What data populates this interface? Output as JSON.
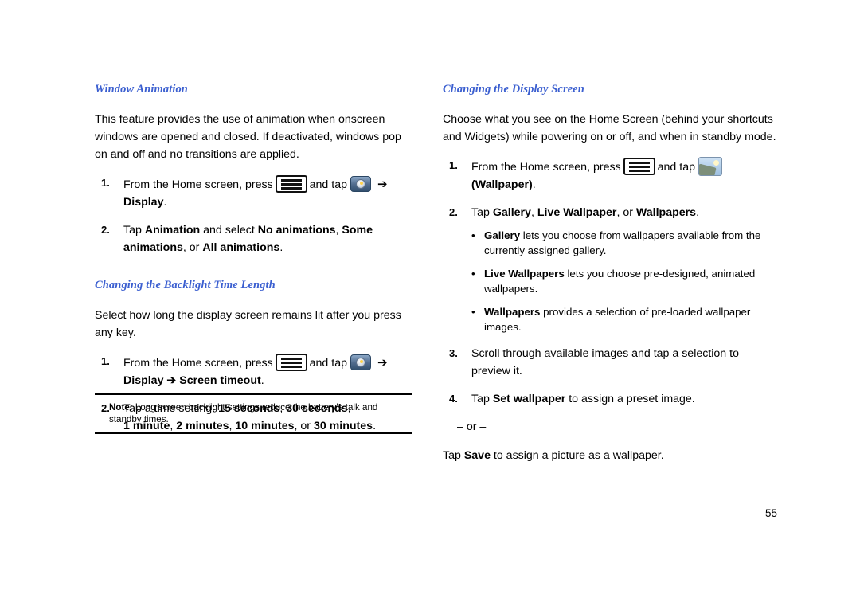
{
  "page": {
    "number": "55"
  },
  "left_column": {
    "section1": {
      "heading": "Window Animation",
      "intro": "This feature provides the use of animation when onscreen windows are opened and closed. If deactivated, windows pop on and off and no transitions are applied.",
      "steps": [
        {
          "num": "1.",
          "pre": "From the Home screen, press",
          "mid": "and tap",
          "post": "Display",
          "post_tail": "."
        },
        {
          "num": "2.",
          "t1": "Tap ",
          "b1": "Animation",
          "t2": " and select ",
          "b2": "No animations",
          "t3": ", ",
          "b3": "Some animations",
          "t4": ", or ",
          "b4": "All animations",
          "t5": "."
        }
      ]
    },
    "section2": {
      "heading": "Changing the Backlight Time Length",
      "intro": "Select how long the display screen remains lit after you press any key.",
      "steps": [
        {
          "num": "1.",
          "pre": "From the Home screen, press",
          "mid": "and tap",
          "post": "Display ➔ Screen timeout",
          "post_tail": "."
        },
        {
          "num": "2.",
          "t1": "Tap a time setting: ",
          "b1": "15 seconds",
          "t2": ", ",
          "b2": "30 seconds",
          "t3": ", ",
          "b3": "1 minute",
          "t4": ", ",
          "b4": "2 minutes",
          "t5": ", ",
          "b5": "10 minutes",
          "t6": ", or ",
          "b6": "30 minutes",
          "t7": "."
        }
      ]
    },
    "note": {
      "label": "Note:",
      "text": "Long screen backlight settings reduce the battery's talk and standby times."
    }
  },
  "right_column": {
    "section1": {
      "heading": "Changing the Display Screen",
      "intro": "Choose what you see on the Home Screen (behind your shortcuts and Widgets) while powering on or off, and when in standby mode.",
      "step1": {
        "num": "1.",
        "pre": "From the Home screen, press",
        "mid": "and tap",
        "post": "(Wallpaper)",
        "post_tail": "."
      },
      "step2": {
        "num": "2.",
        "t1": "Tap ",
        "b1": "Gallery",
        "t2": ", ",
        "b2": "Live Wallpaper",
        "t3": ", or ",
        "b3": "Wallpapers",
        "t4": "."
      },
      "bullets": [
        {
          "bold": "Gallery",
          "text": " lets you choose from wallpapers available from the currently assigned gallery."
        },
        {
          "bold": "Live Wallpapers",
          "text": " lets you choose pre-designed, animated wallpapers."
        },
        {
          "bold": "Wallpapers",
          "text": " provides a selection of pre-loaded wallpaper images."
        }
      ],
      "step3": {
        "num": "3.",
        "text": "Scroll through available images and tap a selection to preview it."
      },
      "step4": {
        "num": "4.",
        "t1": "Tap ",
        "b1": "Set wallpaper",
        "t2": " to assign a preset image."
      },
      "or_separator": "– or –",
      "final": {
        "t1": "Tap ",
        "b1": "Save",
        "t2": " to assign a picture as a wallpaper."
      }
    }
  },
  "icons": {
    "menu_key": "menu-key-icon",
    "settings": "settings-gear-icon",
    "wallpaper": "wallpaper-image-icon"
  }
}
